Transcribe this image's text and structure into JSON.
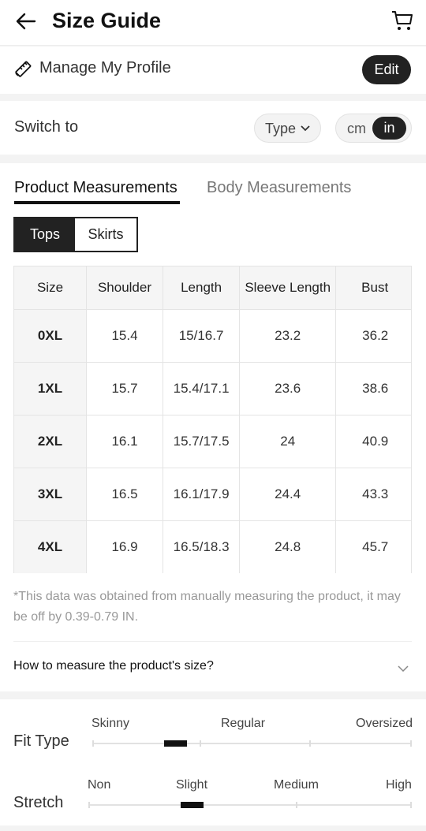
{
  "header": {
    "title": "Size Guide",
    "back_icon": "arrow-left-icon",
    "cart_icon": "cart-icon"
  },
  "profile": {
    "label": "Manage My Profile",
    "edit_label": "Edit",
    "icon": "ruler-icon"
  },
  "switch": {
    "label": "Switch to",
    "type_label": "Type",
    "unit_cm": "cm",
    "unit_in": "in",
    "selected_unit": "in"
  },
  "tabs": [
    {
      "label": "Product Measurements",
      "active": true
    },
    {
      "label": "Body Measurements",
      "active": false
    }
  ],
  "segments": [
    {
      "label": "Tops",
      "active": true
    },
    {
      "label": "Skirts",
      "active": false
    }
  ],
  "table": {
    "headers": [
      "Size",
      "Shoulder",
      "Length",
      "Sleeve Length",
      "Bust"
    ],
    "rows": [
      [
        "0XL",
        "15.4",
        "15/16.7",
        "23.2",
        "36.2"
      ],
      [
        "1XL",
        "15.7",
        "15.4/17.1",
        "23.6",
        "38.6"
      ],
      [
        "2XL",
        "16.1",
        "15.7/17.5",
        "24",
        "40.9"
      ],
      [
        "3XL",
        "16.5",
        "16.1/17.9",
        "24.4",
        "43.3"
      ],
      [
        "4XL",
        "16.9",
        "16.5/18.3",
        "24.8",
        "45.7"
      ]
    ]
  },
  "note": "*This data was obtained from manually measuring the product, it may be off by 0.39-0.79 IN.",
  "measure_link": "How to measure the product's size?",
  "fit": {
    "fit_type": {
      "label": "Fit Type",
      "scale": [
        "Skinny",
        "Regular",
        "Oversized"
      ],
      "value": "Skinny"
    },
    "stretch": {
      "label": "Stretch",
      "scale": [
        "Non",
        "Slight",
        "Medium",
        "High"
      ],
      "value": "Slight"
    }
  },
  "colors": {
    "accent": "#222222",
    "muted": "#999999",
    "background": "#f3f3f3"
  }
}
